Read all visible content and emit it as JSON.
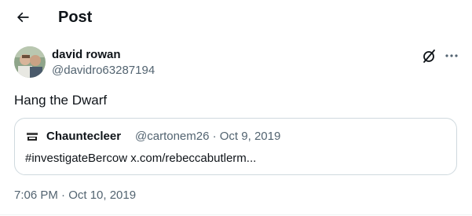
{
  "header": {
    "back_icon": "arrow-left-icon",
    "title": "Post"
  },
  "author": {
    "display_name": "david rowan",
    "handle": "@davidro63287194",
    "avatar_icon": "user-avatar"
  },
  "actions": {
    "grok_icon": "grok-icon",
    "more_icon": "more-horizontal-icon"
  },
  "tweet": {
    "text": "Hang the Dwarf"
  },
  "quote": {
    "display_name": "Chauntecleer",
    "meta": "@cartonem26 · Oct 9, 2019",
    "text": "#investigateBercow x.com/rebeccabutlerm..."
  },
  "timestamp": "7:06 PM · Oct 10, 2019",
  "colors": {
    "text_primary": "#0f1419",
    "text_secondary": "#536471",
    "border": "#cfd9de"
  }
}
